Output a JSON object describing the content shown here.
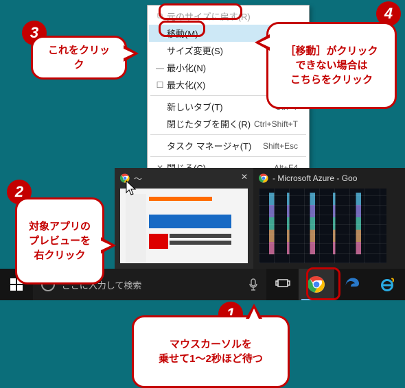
{
  "menu": {
    "items": [
      {
        "icon": "⧉",
        "label": "元のサイズに戻す(R)",
        "shortcut": "",
        "disabled": true
      },
      {
        "icon": "",
        "label": "移動(M)",
        "shortcut": "",
        "selected": true
      },
      {
        "icon": "",
        "label": "サイズ変更(S)",
        "shortcut": ""
      },
      {
        "icon": "—",
        "label": "最小化(N)",
        "shortcut": ""
      },
      {
        "icon": "☐",
        "label": "最大化(X)",
        "shortcut": ""
      },
      {
        "sep": true
      },
      {
        "icon": "",
        "label": "新しいタブ(T)",
        "shortcut": "Ctrl+T"
      },
      {
        "icon": "",
        "label": "閉じたタブを開く(R)",
        "shortcut": "Ctrl+Shift+T"
      },
      {
        "sep": true
      },
      {
        "icon": "",
        "label": "タスク マネージャ(T)",
        "shortcut": "Shift+Esc"
      },
      {
        "sep": true
      },
      {
        "icon": "✕",
        "label": "閉じる(C)",
        "shortcut": "Alt+F4"
      }
    ]
  },
  "thumbnails": {
    "items": [
      {
        "title": "～",
        "active": true,
        "close": "✕"
      },
      {
        "title": "- Microsoft Azure - Goo"
      }
    ]
  },
  "taskbar": {
    "search_placeholder": "ここに入力して検索"
  },
  "callouts": {
    "c1": {
      "num": "1",
      "text": "マウスカーソルを\n乗せて1～2秒ほど待つ"
    },
    "c2": {
      "num": "2",
      "text": "対象アプリの\nプレビューを\n右クリック"
    },
    "c3": {
      "num": "3",
      "text": "これをクリック"
    },
    "c4": {
      "num": "4",
      "text": "［移動］がクリック\nできない場合は\nこちらをクリック"
    }
  }
}
